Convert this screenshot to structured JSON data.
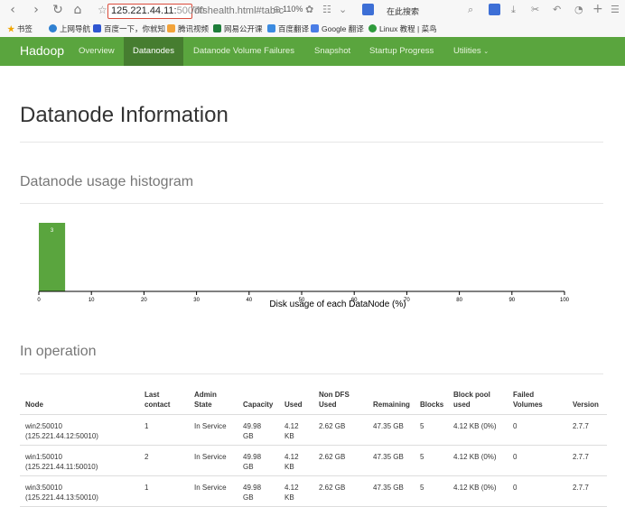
{
  "browser": {
    "url_host": "125.221.44.11:",
    "url_port": "50070",
    "url_rest": "/dfshealth.html#tab-c",
    "zoom": "110%",
    "search_placeholder": "在此搜索",
    "bookmarks": [
      "书签",
      "上网导航",
      "百度一下，你就知",
      "腾讯视频",
      "网易公开课",
      "百度翻译",
      "Google 翻译",
      "Linux 教程 | 菜鸟"
    ]
  },
  "navbar": {
    "brand": "Hadoop",
    "items": [
      "Overview",
      "Datanodes",
      "Datanode Volume Failures",
      "Snapshot",
      "Startup Progress",
      "Utilities"
    ],
    "active_index": 1,
    "accent": "#5aa53e",
    "active_bg": "#467d30"
  },
  "page": {
    "title": "Datanode Information",
    "histogram_title": "Datanode usage histogram",
    "in_operation_title": "In operation"
  },
  "chart_data": {
    "type": "bar",
    "xlabel": "Disk usage of each DataNode (%)",
    "ylabel": "",
    "xlim": [
      0,
      100
    ],
    "xticks": [
      0,
      10,
      20,
      30,
      40,
      50,
      60,
      70,
      80,
      90,
      100
    ],
    "bins": [
      {
        "x0": 0,
        "x1": 5,
        "count": 3
      }
    ],
    "bar_color": "#5aa53e"
  },
  "table": {
    "headers": [
      {
        "line1": "Node",
        "line2": ""
      },
      {
        "line1": "Last",
        "line2": "contact"
      },
      {
        "line1": "Admin",
        "line2": "State"
      },
      {
        "line1": "Capacity",
        "line2": ""
      },
      {
        "line1": "Used",
        "line2": ""
      },
      {
        "line1": "Non DFS",
        "line2": "Used"
      },
      {
        "line1": "Remaining",
        "line2": ""
      },
      {
        "line1": "Blocks",
        "line2": ""
      },
      {
        "line1": "Block pool",
        "line2": "used"
      },
      {
        "line1": "Failed",
        "line2": "Volumes"
      },
      {
        "line1": "Version",
        "line2": ""
      }
    ],
    "rows": [
      {
        "node": "win2:50010",
        "node_addr": "(125.221.44.12:50010)",
        "last_contact": "1",
        "admin_state": "In Service",
        "capacity_1": "49.98",
        "capacity_2": "GB",
        "used_1": "4.12",
        "used_2": "KB",
        "non_dfs_used": "2.62 GB",
        "remaining": "47.35 GB",
        "blocks": "5",
        "block_pool_used": "4.12 KB (0%)",
        "failed_volumes": "0",
        "version": "2.7.7"
      },
      {
        "node": "win1:50010",
        "node_addr": "(125.221.44.11:50010)",
        "last_contact": "2",
        "admin_state": "In Service",
        "capacity_1": "49.98",
        "capacity_2": "GB",
        "used_1": "4.12",
        "used_2": "KB",
        "non_dfs_used": "2.62 GB",
        "remaining": "47.35 GB",
        "blocks": "5",
        "block_pool_used": "4.12 KB (0%)",
        "failed_volumes": "0",
        "version": "2.7.7"
      },
      {
        "node": "win3:50010",
        "node_addr": "(125.221.44.13:50010)",
        "last_contact": "1",
        "admin_state": "In Service",
        "capacity_1": "49.98",
        "capacity_2": "GB",
        "used_1": "4.12",
        "used_2": "KB",
        "non_dfs_used": "2.62 GB",
        "remaining": "47.35 GB",
        "blocks": "5",
        "block_pool_used": "4.12 KB (0%)",
        "failed_volumes": "0",
        "version": "2.7.7"
      }
    ]
  }
}
